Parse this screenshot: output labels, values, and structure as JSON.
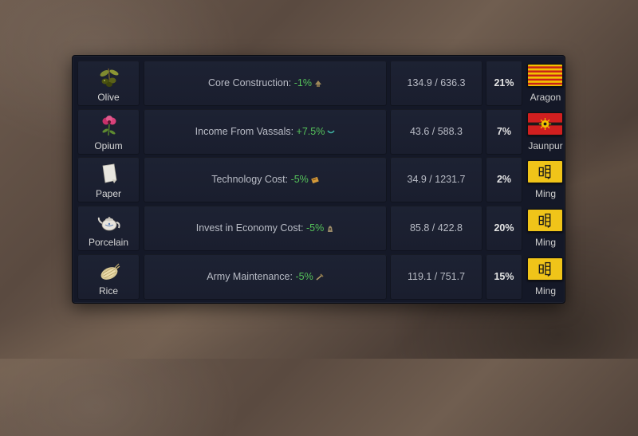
{
  "trade_rows": [
    {
      "good_name": "Olive",
      "good_icon": "olive-icon",
      "modifier_label": "Core Construction: ",
      "modifier_value": "-1%",
      "modifier_icon": "core-construction-icon",
      "value": "134.9 / 636.3",
      "percent": "21%",
      "owner": "Aragon",
      "flag_icon": "aragon-flag-icon"
    },
    {
      "good_name": "Opium",
      "good_icon": "opium-poppy-icon",
      "modifier_label": "Income From Vassals: ",
      "modifier_value": "+7.5%",
      "modifier_icon": "vassal-income-icon",
      "value": "43.6 / 588.3",
      "percent": "7%",
      "owner": "Jaunpur",
      "flag_icon": "jaunpur-flag-icon"
    },
    {
      "good_name": "Paper",
      "good_icon": "paper-icon",
      "modifier_label": "Technology Cost: ",
      "modifier_value": "-5%",
      "modifier_icon": "technology-cost-icon",
      "value": "34.9 / 1231.7",
      "percent": "2%",
      "owner": "Ming",
      "flag_icon": "ming-flag-icon"
    },
    {
      "good_name": "Porcelain",
      "good_icon": "porcelain-teapot-icon",
      "modifier_label": "Invest in Economy Cost: ",
      "modifier_value": "-5%",
      "modifier_icon": "economy-cost-icon",
      "value": "85.8 / 422.8",
      "percent": "20%",
      "owner": "Ming",
      "flag_icon": "ming-flag-icon"
    },
    {
      "good_name": "Rice",
      "good_icon": "rice-icon",
      "modifier_label": "Army Maintenance: ",
      "modifier_value": "-5%",
      "modifier_icon": "army-maintenance-icon",
      "value": "119.1 / 751.7",
      "percent": "15%",
      "owner": "Ming",
      "flag_icon": "ming-flag-icon"
    }
  ],
  "colors": {
    "modifier_positive": "#55c25a",
    "panel_bg": "#141827",
    "cell_bg": "#1d2233",
    "aragon_gold": "#f2c200",
    "aragon_red": "#c8201a",
    "jaunpur_red": "#d11f1f",
    "ming_yellow": "#f0c419"
  }
}
